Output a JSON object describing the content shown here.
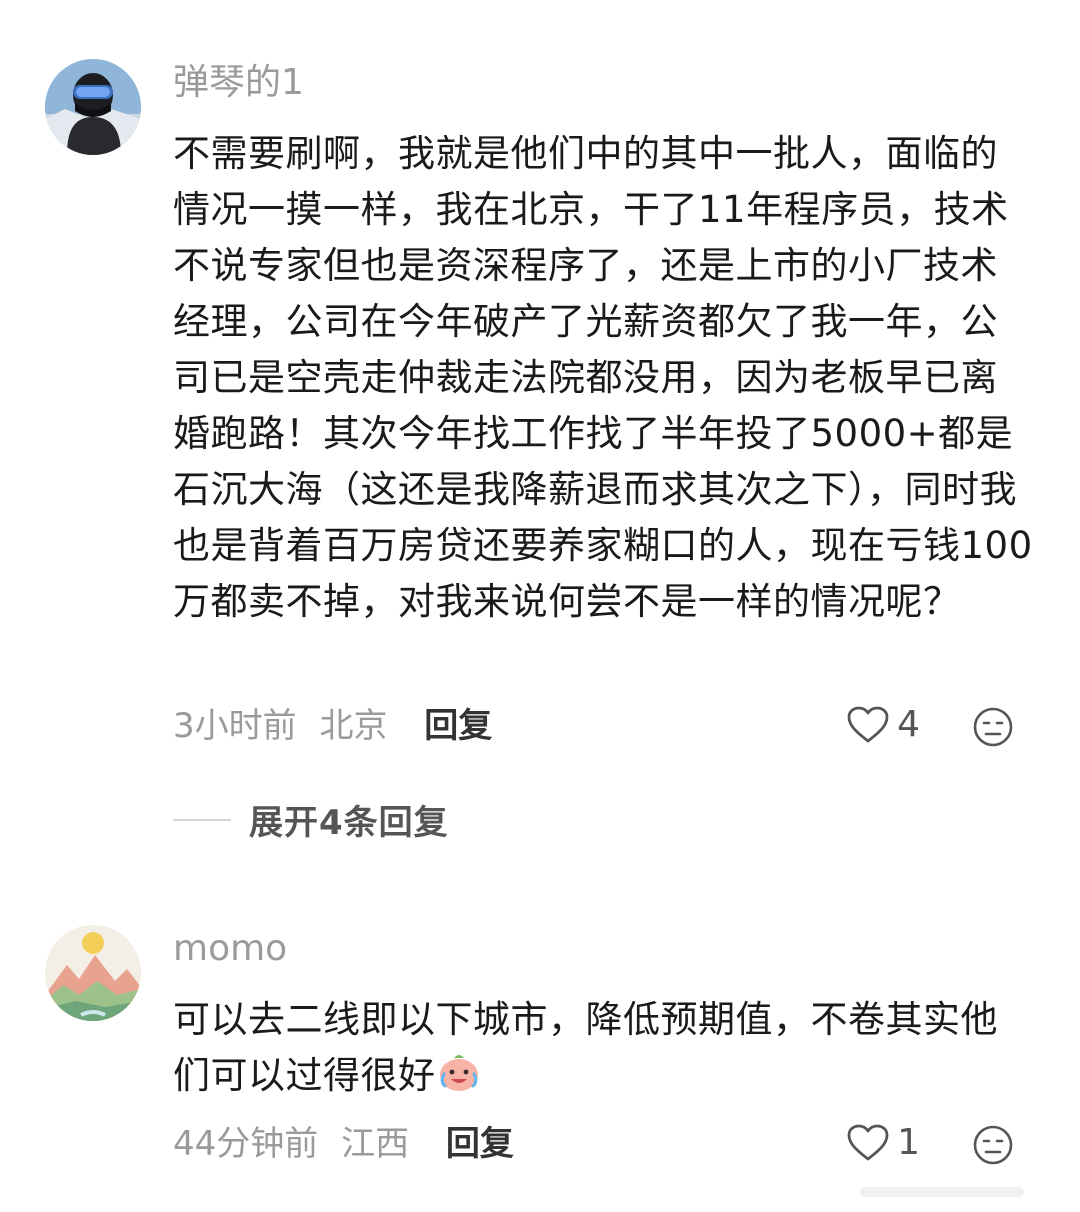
{
  "comments": [
    {
      "username": "弹琴的1",
      "text": "不需要刷啊，我就是他们中的其中一批人，面临的情况一摸一样，我在北京，干了11年程序员，技术不说专家但也是资深程序了，还是上市的小厂技术经理，公司在今年破产了光薪资都欠了我一年，公司已是空壳走仲裁走法院都没用，因为老板早已离婚跑路！其次今年找工作找了半年投了5000+都是石沉大海（这还是我降薪退而求其次之下），同时我也是背着百万房贷还要养家糊口的人，现在亏钱100万都卖不掉，对我来说何尝不是一样的情况呢？",
      "time": "3小时前",
      "location": "北京",
      "reply_label": "回复",
      "likes": "4",
      "avatar_icon": "skier-avatar"
    },
    {
      "username": "momo",
      "text": "可以去二线即以下城市，降低预期值，不卷其实他们可以过得很好",
      "time": "44分钟前",
      "location": "江西",
      "reply_label": "回复",
      "likes": "1",
      "avatar_icon": "mountain-sun-avatar",
      "inline_emoji": "crying-laughing-peach-emoji"
    }
  ],
  "expand_replies": "展开4条回复",
  "colors": {
    "username": "#9a9a9a",
    "text": "#1a1a1a",
    "meta": "#9a9a9a"
  }
}
